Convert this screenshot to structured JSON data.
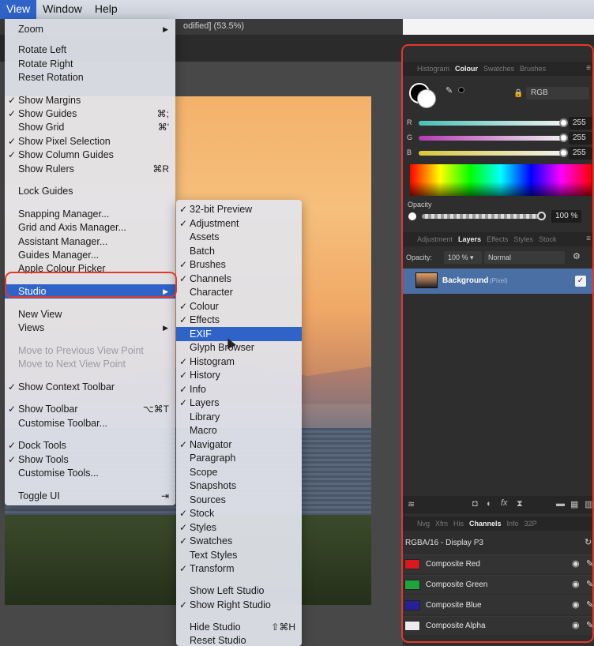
{
  "menubar": {
    "items": [
      "View",
      "Window",
      "Help"
    ]
  },
  "document_title": "odified] (53.5%)",
  "view_menu": {
    "items": [
      {
        "label": "Zoom",
        "arrow": "▶"
      },
      {
        "label": "Rotate Left"
      },
      {
        "label": "Rotate Right"
      },
      {
        "label": "Reset Rotation"
      },
      {
        "label": "Show Margins",
        "check": "✓"
      },
      {
        "label": "Show Guides",
        "check": "✓",
        "shortcut": "⌘;"
      },
      {
        "label": "Show Grid",
        "shortcut": "⌘'"
      },
      {
        "label": "Show Pixel Selection",
        "check": "✓"
      },
      {
        "label": "Show Column Guides",
        "check": "✓"
      },
      {
        "label": "Show Rulers",
        "shortcut": "⌘R"
      },
      {
        "label": "Lock Guides"
      },
      {
        "label": "Snapping Manager..."
      },
      {
        "label": "Grid and Axis Manager..."
      },
      {
        "label": "Assistant Manager..."
      },
      {
        "label": "Guides Manager..."
      },
      {
        "label": "Apple Colour Picker"
      },
      {
        "label": "Studio",
        "arrow": "▶"
      },
      {
        "label": "New View"
      },
      {
        "label": "Views",
        "arrow": "▶"
      },
      {
        "label": "Move to Previous View Point"
      },
      {
        "label": "Move to Next View Point"
      },
      {
        "label": "Show Context Toolbar",
        "check": "✓"
      },
      {
        "label": "Show Toolbar",
        "check": "✓",
        "shortcut": "⌥⌘T"
      },
      {
        "label": "Customise Toolbar..."
      },
      {
        "label": "Dock Tools",
        "check": "✓"
      },
      {
        "label": "Show Tools",
        "check": "✓"
      },
      {
        "label": "Customise Tools..."
      },
      {
        "label": "Toggle UI",
        "shortcut": "⇥"
      }
    ]
  },
  "studio_menu": {
    "items": [
      {
        "label": "32-bit Preview",
        "check": "✓"
      },
      {
        "label": "Adjustment",
        "check": "✓"
      },
      {
        "label": "Assets"
      },
      {
        "label": "Batch"
      },
      {
        "label": "Brushes",
        "check": "✓"
      },
      {
        "label": "Channels",
        "check": "✓"
      },
      {
        "label": "Character"
      },
      {
        "label": "Colour",
        "check": "✓"
      },
      {
        "label": "Effects",
        "check": "✓"
      },
      {
        "label": "EXIF"
      },
      {
        "label": "Glyph Browser"
      },
      {
        "label": "Histogram",
        "check": "✓"
      },
      {
        "label": "History",
        "check": "✓"
      },
      {
        "label": "Info",
        "check": "✓"
      },
      {
        "label": "Layers",
        "check": "✓"
      },
      {
        "label": "Library"
      },
      {
        "label": "Macro"
      },
      {
        "label": "Navigator",
        "check": "✓"
      },
      {
        "label": "Paragraph"
      },
      {
        "label": "Scope"
      },
      {
        "label": "Snapshots"
      },
      {
        "label": "Sources"
      },
      {
        "label": "Stock",
        "check": "✓"
      },
      {
        "label": "Styles",
        "check": "✓"
      },
      {
        "label": "Swatches",
        "check": "✓"
      },
      {
        "label": "Text Styles"
      },
      {
        "label": "Transform",
        "check": "✓"
      },
      {
        "label": "Show Left Studio"
      },
      {
        "label": "Show Right Studio",
        "check": "✓"
      },
      {
        "label": "Hide Studio",
        "shortcut": "⇧⌘H"
      },
      {
        "label": "Reset Studio"
      }
    ]
  },
  "colour_panel": {
    "tabs": [
      "Histogram",
      "Colour",
      "Swatches",
      "Brushes"
    ],
    "active_tab": "Colour",
    "model": "RGB",
    "channels": [
      {
        "label": "R",
        "value": "255"
      },
      {
        "label": "G",
        "value": "255"
      },
      {
        "label": "B",
        "value": "255"
      }
    ],
    "opacity_label": "Opacity",
    "opacity_value": "100 %"
  },
  "layers_panel": {
    "tabs": [
      "Adjustment",
      "Layers",
      "Effects",
      "Styles",
      "Stock"
    ],
    "active_tab": "Layers",
    "opacity_label": "Opacity:",
    "opacity_value": "100 %",
    "blend_mode": "Normal",
    "layer_name": "Background",
    "layer_tag": "(Pixel)"
  },
  "channels_panel": {
    "tabs": [
      "Nvg",
      "Xfm",
      "His",
      "Channels",
      "Info",
      "32P"
    ],
    "active_tab": "Channels",
    "format": "RGBA/16 - Display P3",
    "channels": [
      {
        "label": "Composite Red",
        "color": "#d8191e"
      },
      {
        "label": "Composite Green",
        "color": "#1ea43c"
      },
      {
        "label": "Composite Blue",
        "color": "#26219a"
      },
      {
        "label": "Composite Alpha",
        "color": "#ececec"
      }
    ]
  },
  "colors": {
    "highlight": "#2f63c7",
    "annotation": "#e2392b",
    "layer_selected": "#4a6fa5"
  }
}
